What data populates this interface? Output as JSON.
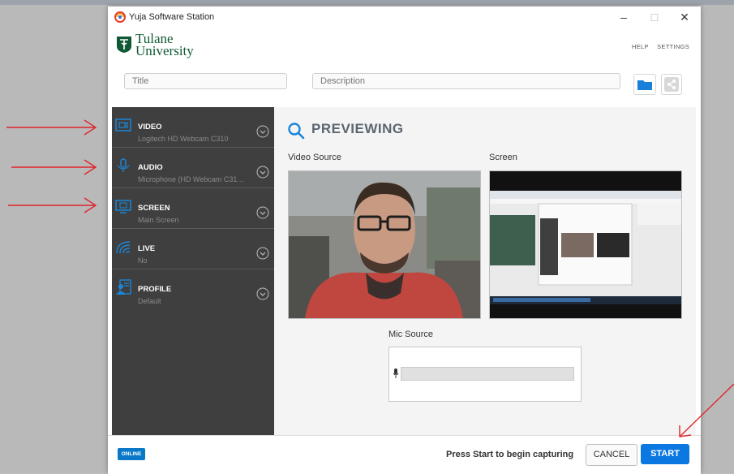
{
  "window": {
    "title": "Yuja Software Station",
    "controls": [
      "minimize-icon",
      "maximize-icon",
      "close-icon"
    ],
    "minimize_symbol": "–",
    "maximize_symbol": "□",
    "close_symbol": "✕"
  },
  "brand": {
    "line1": "Tulane",
    "line2": "University"
  },
  "top_links": {
    "help": "HELP",
    "settings": "SETTINGS"
  },
  "inputs": {
    "title": {
      "value": "",
      "placeholder": "Title"
    },
    "description": {
      "value": "",
      "placeholder": "Description"
    }
  },
  "sidebar": {
    "items": [
      {
        "label": "VIDEO",
        "sub": "Logitech HD Webcam C310",
        "icon": "video-icon"
      },
      {
        "label": "AUDIO",
        "sub": "Microphone (HD Webcam C31…",
        "icon": "microphone-icon"
      },
      {
        "label": "SCREEN",
        "sub": "Main Screen",
        "icon": "screen-icon"
      },
      {
        "label": "LIVE",
        "sub": "No",
        "icon": "broadcast-icon"
      },
      {
        "label": "PROFILE",
        "sub": "Default",
        "icon": "profile-icon"
      }
    ]
  },
  "main": {
    "heading": "PREVIEWING",
    "video_source_label": "Video Source",
    "screen_label": "Screen",
    "mic_source_label": "Mic Source",
    "mic_level": 0.0
  },
  "footer": {
    "status_badge": "ONLINE",
    "hint": "Press Start to begin capturing",
    "cancel": "CANCEL",
    "start": "START"
  },
  "colors": {
    "sidebar_bg": "#3f3f3f",
    "accent": "#0a78e0",
    "brand_green": "#0f5a34",
    "annotation_red": "#e0262c"
  }
}
